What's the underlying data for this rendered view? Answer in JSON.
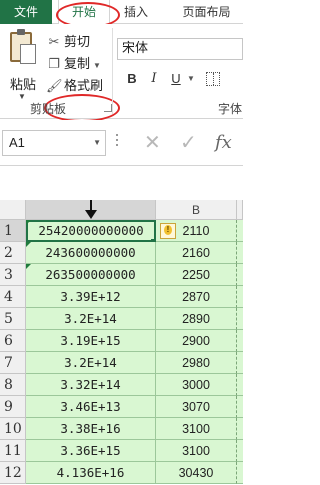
{
  "tabs": {
    "file": "文件",
    "home": "开始",
    "insert": "插入",
    "page_layout": "页面布局"
  },
  "clipboard": {
    "paste": "粘贴",
    "cut": "剪切",
    "copy": "复制",
    "format_painter": "格式刷",
    "group_label": "剪贴板"
  },
  "font": {
    "name": "宋体",
    "bold": "B",
    "italic": "I",
    "underline": "U",
    "group_label": "字体"
  },
  "formula_bar": {
    "name_box": "A1",
    "cancel": "✕",
    "enter": "✓",
    "fx": "fx"
  },
  "sheet": {
    "corner": "",
    "columns": [
      "",
      "B"
    ],
    "rows": [
      {
        "num": "1",
        "a": "25420000000000",
        "b": "2110"
      },
      {
        "num": "2",
        "a": "243600000000",
        "b": "2160"
      },
      {
        "num": "3",
        "a": "263500000000",
        "b": "2250"
      },
      {
        "num": "4",
        "a": "3.39E+12",
        "b": "2870"
      },
      {
        "num": "5",
        "a": "3.2E+14",
        "b": "2890"
      },
      {
        "num": "6",
        "a": "3.19E+15",
        "b": "2900"
      },
      {
        "num": "7",
        "a": "3.2E+14",
        "b": "2980"
      },
      {
        "num": "8",
        "a": "3.32E+14",
        "b": "3000"
      },
      {
        "num": "9",
        "a": "3.46E+13",
        "b": "3070"
      },
      {
        "num": "10",
        "a": "3.38E+16",
        "b": "3100"
      },
      {
        "num": "11",
        "a": "3.36E+15",
        "b": "3100"
      },
      {
        "num": "12",
        "a": "4.136E+16",
        "b": "30430"
      }
    ],
    "warning_icon": "!"
  },
  "colors": {
    "accent": "#217346",
    "cell_fill": "#d9f7d2",
    "annotation": "#e02828"
  }
}
